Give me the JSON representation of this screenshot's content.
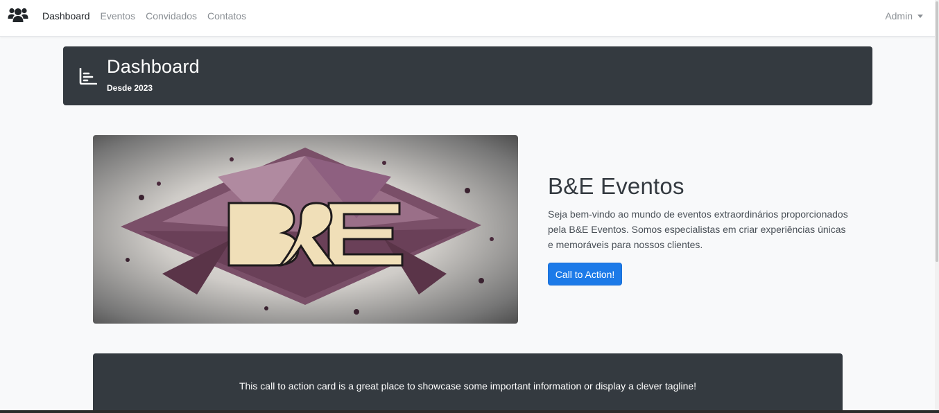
{
  "navbar": {
    "brand_icon": "users-icon",
    "links": [
      {
        "label": "Dashboard",
        "active": true
      },
      {
        "label": "Eventos",
        "active": false
      },
      {
        "label": "Convidados",
        "active": false
      },
      {
        "label": "Contatos",
        "active": false
      }
    ],
    "user_menu_label": "Admin"
  },
  "header": {
    "icon": "chart-icon",
    "title": "Dashboard",
    "subtitle": "Desde 2023"
  },
  "hero": {
    "image_logo_text": "B&E",
    "title": "B&E Eventos",
    "text": "Seja bem-vindo ao mundo de eventos extraordinários proporcionados pela B&E Eventos. Somos especialistas em criar experiências únicas e memoráveis para nossos clientes.",
    "button_label": "Call to Action!"
  },
  "cta_card": {
    "text": "This call to action card is a great place to showcase some important information or display a clever tagline!"
  },
  "colors": {
    "primary": "#1c7ae8",
    "dark": "#343a40",
    "background": "#f8f9fa"
  }
}
